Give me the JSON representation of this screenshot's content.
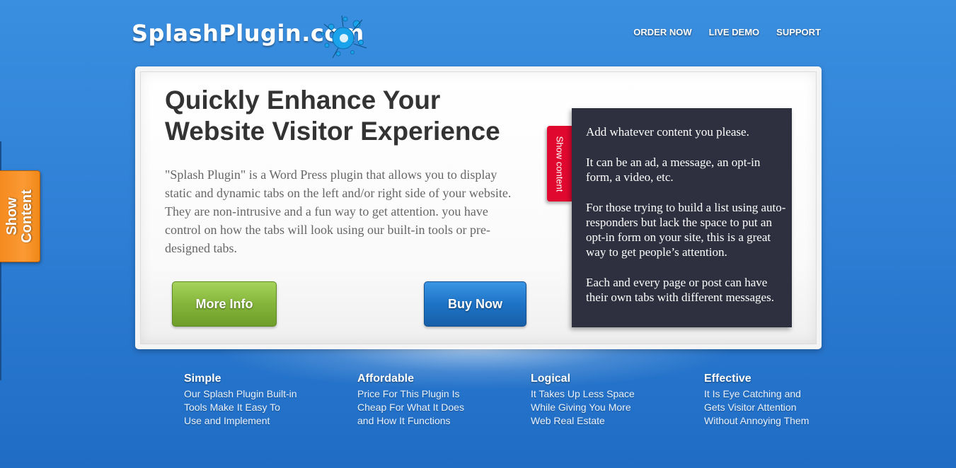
{
  "header": {
    "logo_text": "SplashPlugin.com",
    "nav": [
      {
        "label": "ORDER NOW"
      },
      {
        "label": "LIVE DEMO"
      },
      {
        "label": "SUPPORT"
      }
    ]
  },
  "hero": {
    "headline": "Quickly Enhance Your Website Visitor Experience",
    "description": "\"Splash Plugin\" is a Word Press plugin that allows you to display static and dynamic tabs on the left and/or right side of your website. They are non-intrusive and a fun way to get attention. you have control on how the tabs will look using our built-in tools or pre-designed tabs.",
    "more_info_label": "More Info",
    "buy_now_label": "Buy Now"
  },
  "tab_panel": {
    "tab_label": "Show content",
    "paragraphs": [
      "Add whatever content you please.",
      "It can be an ad, a message, an opt-in form, a video, etc.",
      "For those trying to build a list using auto-responders but lack the space to put an opt-in form on your site, this is a great way to get people’s attention.",
      "Each and every page or post can have their own tabs with different messages."
    ]
  },
  "side_tab": {
    "label": "Show Content"
  },
  "features": [
    {
      "title": "Simple",
      "text": "Our Splash Plugin Built-in Tools Make It Easy To Use and Implement"
    },
    {
      "title": "Affordable",
      "text": "Price For This Plugin Is Cheap For What It Does and How It Functions"
    },
    {
      "title": "Logical",
      "text": "It Takes Up Less Space While Giving You More Web Real Estate"
    },
    {
      "title": "Effective",
      "text": "It Is Eye Catching and Gets Visitor Attention Without Annoying Them"
    }
  ],
  "colors": {
    "background": "#2f80d6",
    "more_info_button": "#84b53a",
    "buy_now_button": "#1e73c6",
    "dark_panel": "#2e303f",
    "red_tab": "#e0082f",
    "orange_tab": "#f7931e"
  },
  "icons": {
    "logo_splash": "splash-icon"
  }
}
